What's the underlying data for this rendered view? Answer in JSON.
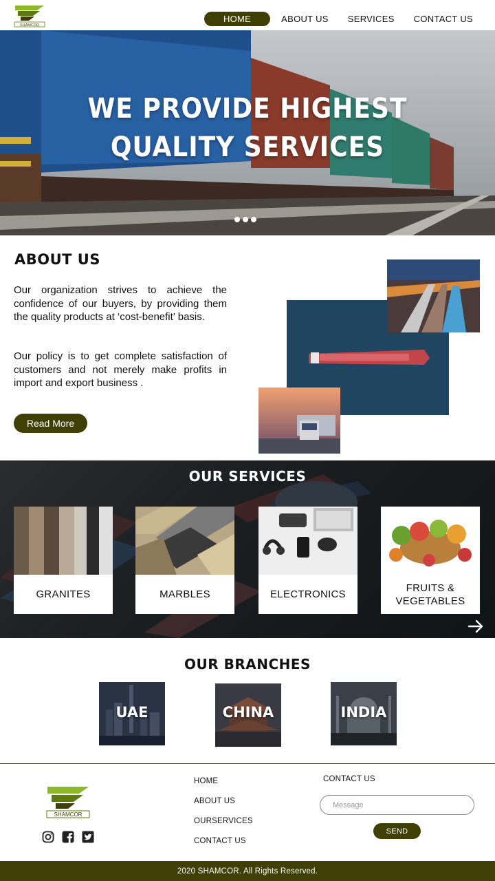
{
  "brand": {
    "logo_text": "SHAMCOR",
    "accent": "#3f3f06",
    "logo_green": "#8db82a"
  },
  "nav": {
    "items": [
      "HOME",
      "ABOUT US",
      "SERVICES",
      "CONTACT US"
    ],
    "active": "HOME"
  },
  "hero": {
    "title_line1": "WE PROVIDE HIGHEST",
    "title_line2": "QUALITY SERVICES",
    "slides": 3
  },
  "about": {
    "title": "ABOUT US",
    "paragraph1": "Our organization strives to achieve the confidence of our buyers, by providing them the quality products at ‘cost-benefit’ basis.",
    "paragraph2": "Our policy is to get complete satisfaction of customers and not merely make profits in import and export business .",
    "read_more": "Read More"
  },
  "services": {
    "title": "OUR SERVICES",
    "items": [
      {
        "label": "GRANITES"
      },
      {
        "label": "MARBLES"
      },
      {
        "label": "ELECTRONICS"
      },
      {
        "label": "FRUITS & VEGETABLES"
      }
    ]
  },
  "branches": {
    "title": "OUR BRANCHES",
    "items": [
      {
        "label": "UAE"
      },
      {
        "label": "CHINA"
      },
      {
        "label": "INDIA"
      }
    ]
  },
  "footer": {
    "links": [
      "HOME",
      "ABOUT US",
      "OURSERVICES",
      "CONTACT US"
    ],
    "contact_title": "CONTACT US",
    "message_placeholder": "Message",
    "send_label": "SEND",
    "copyright": "2020 SHAMCOR. All Rights Reserved.",
    "social_icons": [
      "instagram-icon",
      "facebook-icon",
      "twitter-icon"
    ]
  }
}
